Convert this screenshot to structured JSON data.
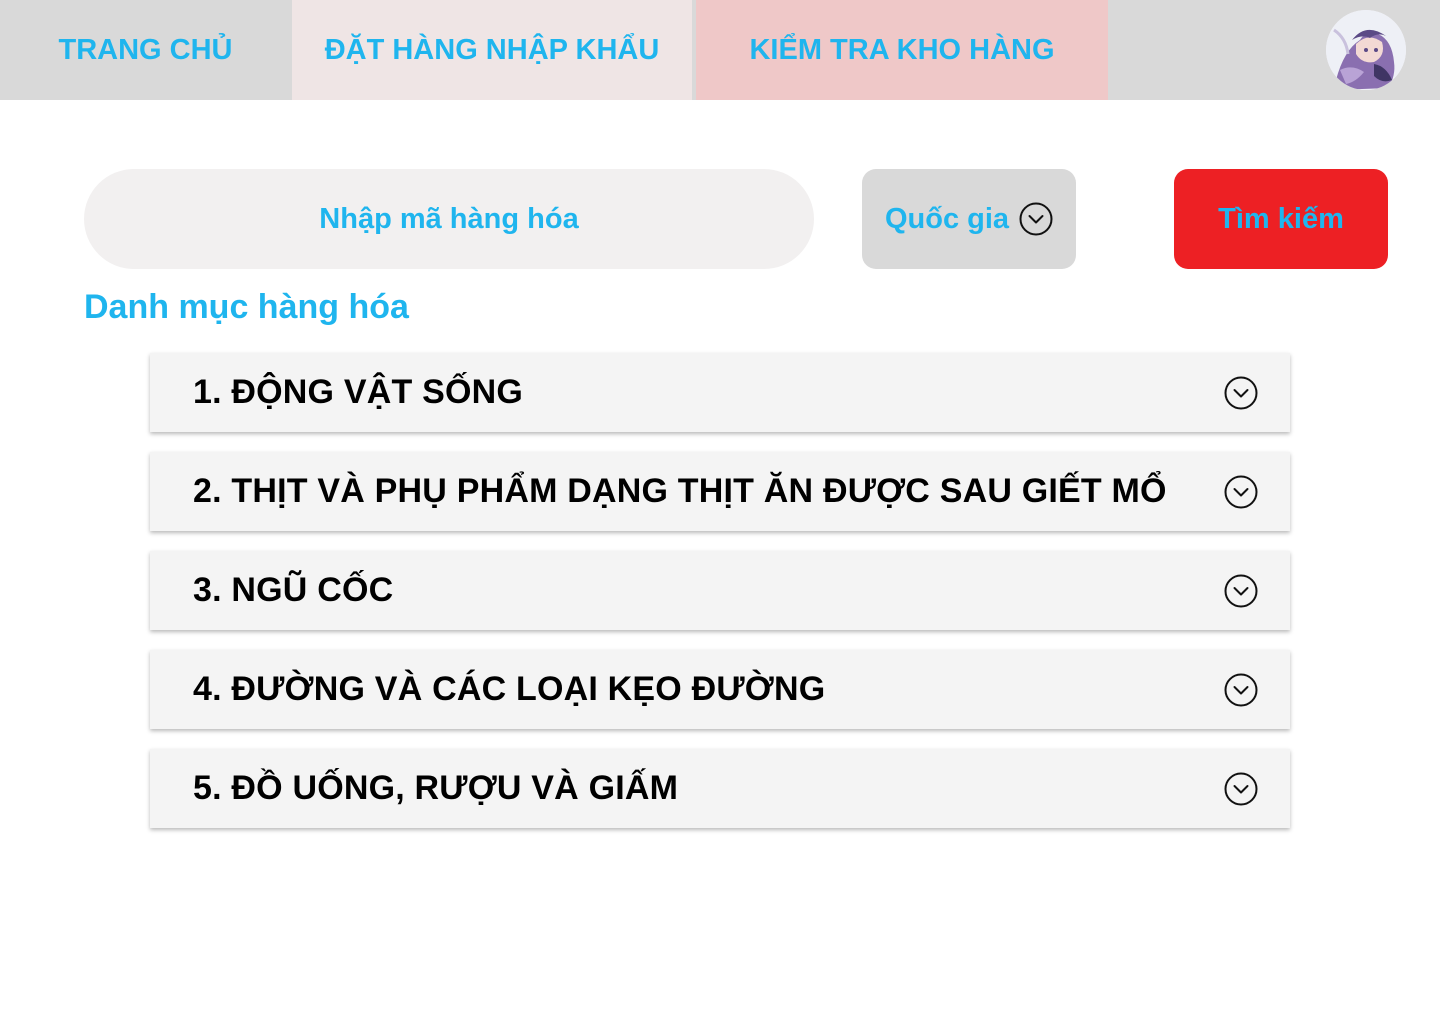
{
  "nav": {
    "tabs": [
      {
        "label": "TRANG CHỦ"
      },
      {
        "label": "ĐẶT HÀNG NHẬP KHẨU"
      },
      {
        "label": "KIỂM TRA KHO HÀNG"
      }
    ],
    "avatar_icon": "user-avatar-icon"
  },
  "search": {
    "placeholder": "Nhập mã hàng hóa",
    "value": "",
    "country_label": "Quốc gia",
    "button_label": "Tìm kiếm"
  },
  "categories": {
    "title": "Danh mục hàng hóa",
    "items": [
      {
        "label": "1. ĐỘNG VẬT SỐNG"
      },
      {
        "label": "2. THỊT VÀ PHỤ PHẨM DẠNG THỊT ĂN ĐƯỢC SAU GIẾT MỔ"
      },
      {
        "label": "3. NGŨ CỐC"
      },
      {
        "label": "4. ĐƯỜNG VÀ CÁC LOẠI KẸO ĐƯỜNG"
      },
      {
        "label": "5. ĐỒ UỐNG, RƯỢU VÀ GIẤM"
      }
    ]
  },
  "colors": {
    "accent_text": "#1fb5ee",
    "nav_bg": "#d9d9d9",
    "tab_import_bg": "#efe5e5",
    "tab_stock_bg": "#efc8c8",
    "search_button_bg": "#ed2024",
    "category_bg": "#f4f4f4"
  }
}
